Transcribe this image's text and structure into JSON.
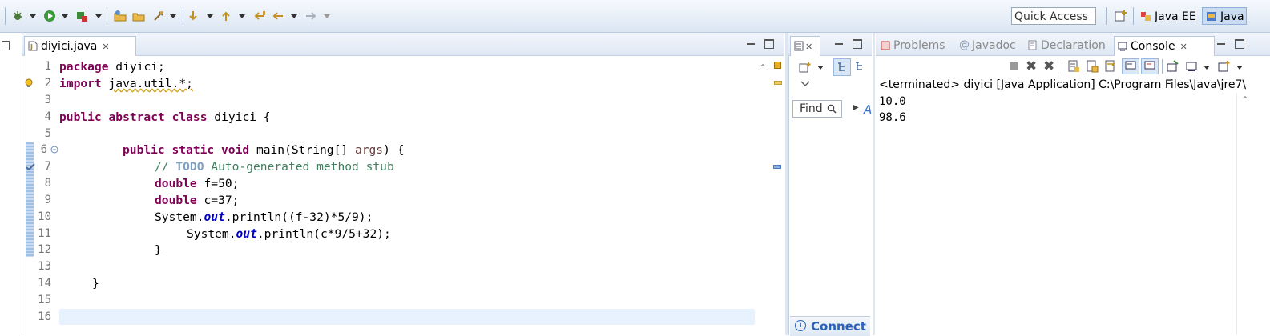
{
  "toolbar": {
    "quick_access_label": "Quick Access",
    "perspectives": [
      {
        "label": "Java EE",
        "icon": "java-ee-perspective-icon",
        "active": false
      },
      {
        "label": "Java",
        "icon": "java-perspective-icon",
        "active": true
      }
    ]
  },
  "editor": {
    "tab_label": "diyici.java",
    "lines": [
      {
        "n": "1"
      },
      {
        "n": "2"
      },
      {
        "n": "3"
      },
      {
        "n": "4"
      },
      {
        "n": "5"
      },
      {
        "n": "6"
      },
      {
        "n": "7"
      },
      {
        "n": "8"
      },
      {
        "n": "9"
      },
      {
        "n": "10"
      },
      {
        "n": "11"
      },
      {
        "n": "12"
      },
      {
        "n": "13"
      },
      {
        "n": "14"
      },
      {
        "n": "15"
      },
      {
        "n": "16"
      }
    ],
    "code": {
      "l1_kw": "package",
      "l1_rest": " diyici;",
      "l2_kw": "import",
      "l2_rest": "java.util.*;",
      "l4_kw": "public abstract class",
      "l4_rest": " diyici {",
      "l6_kw": "public static void",
      "l6_a": " main(String[] ",
      "l6_param": "args",
      "l6_b": ") {",
      "l7_a": "// ",
      "l7_todo": "TODO",
      "l7_b": " Auto-generated method stub",
      "l8_kw": "double",
      "l8_rest": " f=50;",
      "l9_kw": "double",
      "l9_rest": " c=37;",
      "l10_a": "System.",
      "l10_out": "out",
      "l10_b": ".println((f-32)*5/9);",
      "l11_a": "System.",
      "l11_out": "out",
      "l11_b": ".println(c*9/5+32);",
      "l12": "}",
      "l14": "}"
    }
  },
  "outline": {
    "find_label": "Find",
    "connect_label": "Connect"
  },
  "console_view": {
    "tabs": [
      {
        "label": "Problems",
        "active": false
      },
      {
        "label": "Javadoc",
        "active": false
      },
      {
        "label": "Declaration",
        "active": false
      },
      {
        "label": "Console",
        "active": true
      }
    ],
    "header": "<terminated> diyici [Java Application] C:\\Program Files\\Java\\jre7\\",
    "output": [
      "10.0",
      "98.6"
    ]
  }
}
